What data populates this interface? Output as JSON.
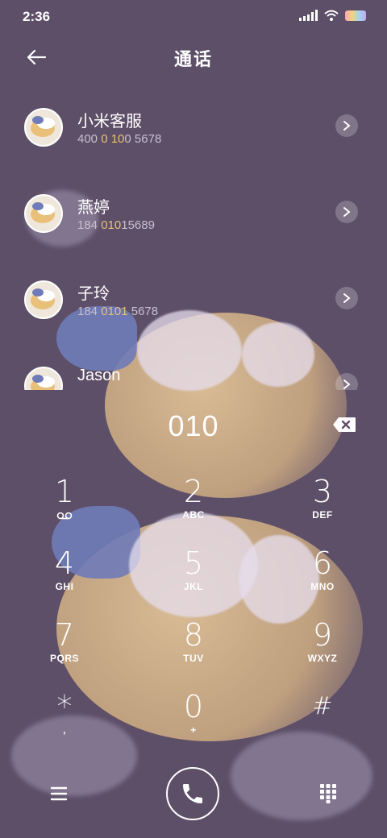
{
  "status_bar": {
    "time": "2:36"
  },
  "header": {
    "title": "通话"
  },
  "contacts": [
    {
      "name": "小米客服",
      "number_parts": [
        "400 ",
        "0",
        " ",
        "10",
        "0 5678"
      ]
    },
    {
      "name": "燕婷",
      "number_parts": [
        "184 ",
        "010",
        "",
        "",
        "15689"
      ]
    },
    {
      "name": "子玲",
      "number_parts": [
        "184 ",
        "0101",
        "",
        "",
        " 5678"
      ]
    },
    {
      "name": "Jason",
      "number_parts": [
        "",
        "",
        "",
        "",
        ""
      ]
    }
  ],
  "dialer": {
    "input": "010"
  },
  "keypad": [
    {
      "digit": "1",
      "letters": ""
    },
    {
      "digit": "2",
      "letters": "ABC"
    },
    {
      "digit": "3",
      "letters": "DEF"
    },
    {
      "digit": "4",
      "letters": "GHI"
    },
    {
      "digit": "5",
      "letters": "JKL"
    },
    {
      "digit": "6",
      "letters": "MNO"
    },
    {
      "digit": "7",
      "letters": "PQRS"
    },
    {
      "digit": "8",
      "letters": "TUV"
    },
    {
      "digit": "9",
      "letters": "WXYZ"
    },
    {
      "digit": "*",
      "letters": ","
    },
    {
      "digit": "0",
      "letters": "+"
    },
    {
      "digit": "#",
      "letters": ""
    }
  ],
  "colors": {
    "background": "#5e4f68",
    "highlight": "#e8c07a",
    "subtext": "#c8bfd0"
  },
  "icons": {
    "back": "arrow-left-icon",
    "chevron": "chevron-right-icon",
    "backspace": "backspace-icon",
    "voicemail": "voicemail-icon",
    "menu": "hamburger-menu-icon",
    "call": "phone-icon",
    "keypad": "keypad-grid-icon"
  }
}
